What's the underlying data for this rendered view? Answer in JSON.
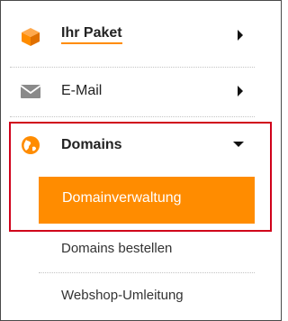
{
  "nav": {
    "items": [
      {
        "label": "Ihr Paket",
        "icon": "package-icon",
        "chevron": "chevron-right-icon"
      },
      {
        "label": "E-Mail",
        "icon": "envelope-icon",
        "chevron": "chevron-right-icon"
      },
      {
        "label": "Domains",
        "icon": "globe-icon",
        "chevron": "chevron-down-icon",
        "expanded": true,
        "subitems": [
          {
            "label": "Domainverwaltung",
            "active": true
          },
          {
            "label": "Domains bestellen"
          },
          {
            "label": "Webshop-Umleitung"
          }
        ]
      }
    ]
  },
  "colors": {
    "accent": "#ff8c00",
    "highlight_border": "#d0021b",
    "icon_gray": "#8a8a8a",
    "text": "#222222"
  }
}
